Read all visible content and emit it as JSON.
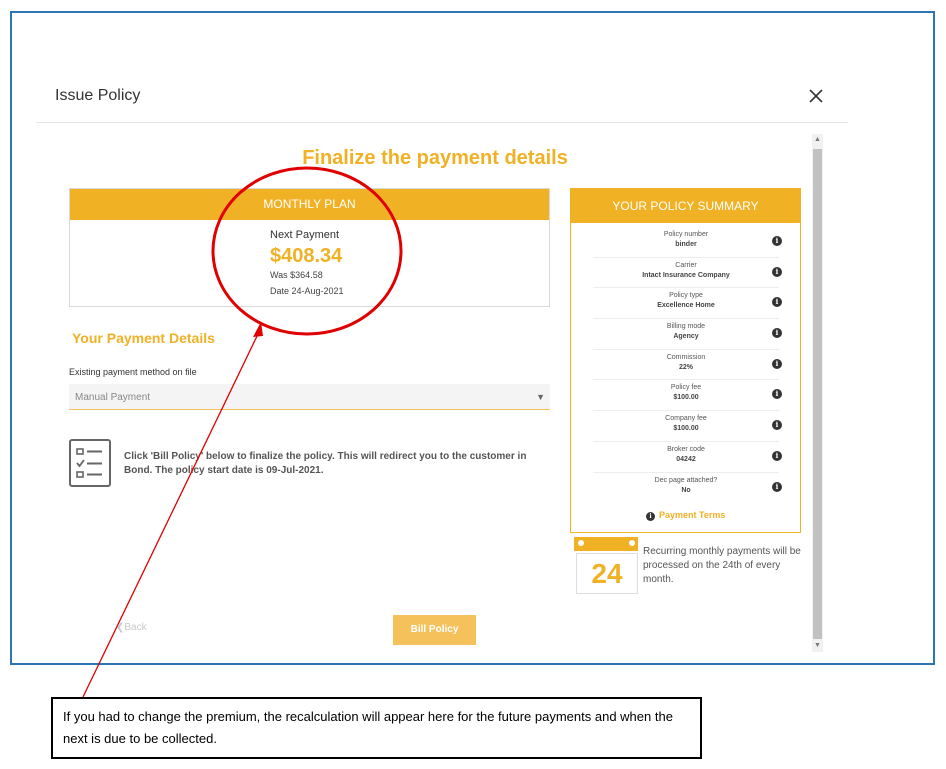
{
  "dialog": {
    "title": "Issue Policy",
    "heading": "Finalize the payment details"
  },
  "plan": {
    "header": "MONTHLY PLAN",
    "next_label": "Next Payment",
    "amount": "$408.34",
    "was": "Was $364.58",
    "date": "Date 24-Aug-2021"
  },
  "payment": {
    "heading": "Your Payment Details",
    "method_label": "Existing payment method on file",
    "method_value": "Manual Payment",
    "info": "Click 'Bill Policy' below to finalize the policy. This will redirect you to the customer in Bond. The policy start date is 09-Jul-2021."
  },
  "summary": {
    "header": "YOUR POLICY SUMMARY",
    "rows": [
      {
        "label": "Policy number",
        "value": "binder"
      },
      {
        "label": "Carrier",
        "value": "Intact Insurance Company"
      },
      {
        "label": "Policy type",
        "value": "Excellence Home"
      },
      {
        "label": "Billing mode",
        "value": "Agency"
      },
      {
        "label": "Commission",
        "value": "22%"
      },
      {
        "label": "Policy fee",
        "value": "$100.00"
      },
      {
        "label": "Company fee",
        "value": "$100.00"
      },
      {
        "label": "Broker code",
        "value": "04242"
      },
      {
        "label": "Dec page attached?",
        "value": "No"
      }
    ],
    "terms": "Payment Terms"
  },
  "calendar": {
    "day": "24",
    "text": "Recurring monthly payments will be processed on the 24th of every month."
  },
  "actions": {
    "back": "Back",
    "bill": "Bill Policy"
  },
  "annotation": {
    "text": "If you had to change the premium, the recalculation will appear here for the future payments and when the next is due to be collected."
  },
  "colors": {
    "accent": "#f0b124",
    "frame": "#2e75b6",
    "annotation": "#e00000"
  },
  "icons": {
    "close": "close-icon",
    "info": "info-icon",
    "checklist": "checklist-icon",
    "calendar": "calendar-icon",
    "back": "chevron-left-icon",
    "dropdown": "caret-down-icon"
  }
}
